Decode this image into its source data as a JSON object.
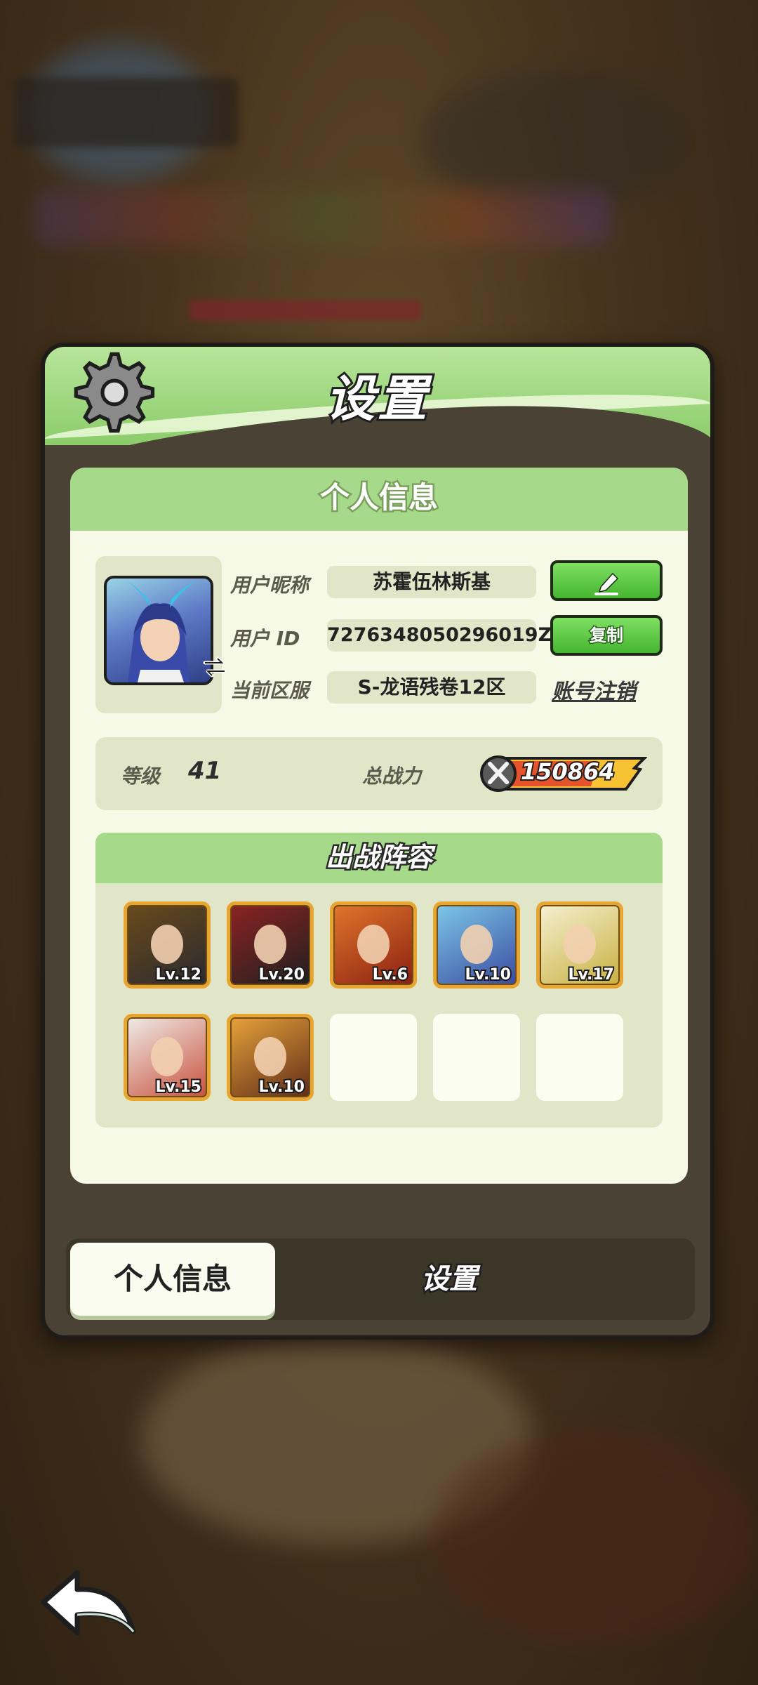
{
  "panel": {
    "title": "设置",
    "gear_icon": "gear-icon"
  },
  "profile": {
    "section_title": "个人信息",
    "nickname_label": "用户昵称",
    "nickname_value": "苏霍伍林斯基",
    "id_label": "用户 ID",
    "id_value": "7276348050296019Z",
    "server_label": "当前区服",
    "server_value": "S-龙语残卷12区",
    "edit_icon": "pencil-icon",
    "copy_label": "复制",
    "deactivate_label": "账号注销"
  },
  "stats": {
    "level_label": "等级",
    "level_value": "41",
    "power_label": "总战力",
    "power_value": "150864"
  },
  "team": {
    "title": "出战阵容",
    "heroes": [
      {
        "level": "Lv.12",
        "colors": [
          "#6a4a1a",
          "#2a2a30"
        ]
      },
      {
        "level": "Lv.20",
        "colors": [
          "#8b2222",
          "#202020"
        ]
      },
      {
        "level": "Lv.6",
        "colors": [
          "#e0762b",
          "#8b1f12"
        ]
      },
      {
        "level": "Lv.10",
        "colors": [
          "#7cc8e8",
          "#3a4aa0"
        ]
      },
      {
        "level": "Lv.17",
        "colors": [
          "#f5f0d0",
          "#c9b040"
        ]
      },
      {
        "level": "Lv.15",
        "colors": [
          "#f0ece8",
          "#c8503c"
        ]
      },
      {
        "level": "Lv.10",
        "colors": [
          "#e8a23a",
          "#5e2c18"
        ]
      }
    ],
    "empty_slots": 3
  },
  "tabs": {
    "active": "个人信息",
    "inactive": "设置"
  },
  "colors": {
    "accent_green": "#8ccc6a",
    "button_green": "#44b52f",
    "frame_gold": "#e8a630"
  }
}
